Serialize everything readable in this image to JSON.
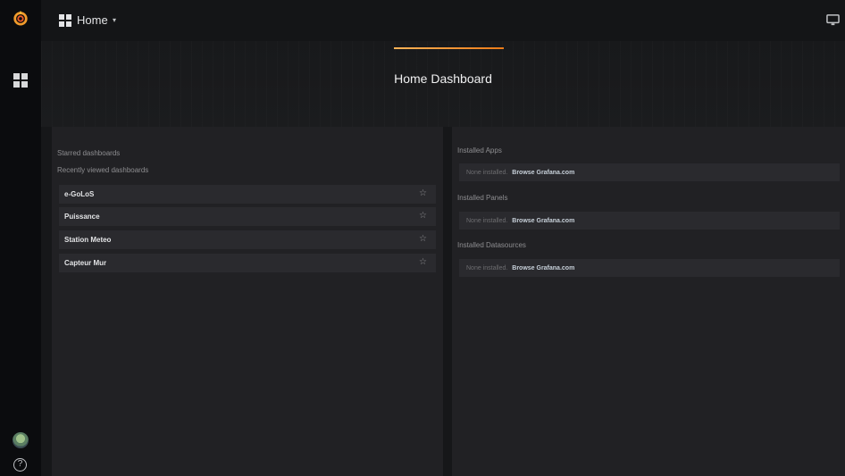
{
  "colors": {
    "background": "#161719",
    "sidemenu": "#0b0c0e",
    "panel": "#212124",
    "row": "#2a2a2e",
    "accent_orange": "#eb7b18"
  },
  "sidemenu": {
    "logo_icon": "grafana-logo-icon",
    "dashboards_icon": "grid-icon",
    "avatar_icon": "user-avatar-icon",
    "help_icon": "help-icon"
  },
  "navbar": {
    "title": "Home",
    "caret": "▾",
    "tv_icon": "tv-monitor-icon"
  },
  "hero": {
    "title": "Home Dashboard"
  },
  "left_panel": {
    "starred_label": "Starred dashboards",
    "recent_label": "Recently viewed dashboards",
    "recent_dashboards": [
      {
        "name": "e-GoLoS",
        "star": "☆"
      },
      {
        "name": "Puissance",
        "star": "☆"
      },
      {
        "name": "Station Meteo",
        "star": "☆"
      },
      {
        "name": "Capteur Mur",
        "star": "☆"
      }
    ]
  },
  "right_panel": {
    "sections": [
      {
        "label": "Installed Apps",
        "none_text": "None installed.",
        "link_text": "Browse Grafana.com"
      },
      {
        "label": "Installed Panels",
        "none_text": "None installed.",
        "link_text": "Browse Grafana.com"
      },
      {
        "label": "Installed Datasources",
        "none_text": "None installed.",
        "link_text": "Browse Grafana.com"
      }
    ]
  },
  "help_glyph": "?"
}
